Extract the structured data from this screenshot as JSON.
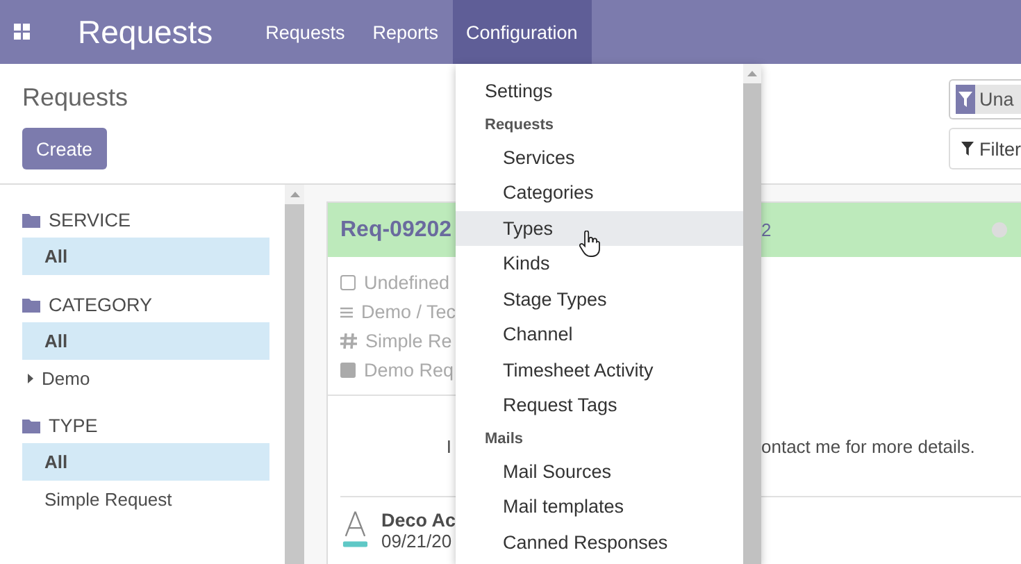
{
  "navbar": {
    "app_title": "Requests",
    "menus": [
      {
        "label": "Requests",
        "selected": false
      },
      {
        "label": "Reports",
        "selected": false
      },
      {
        "label": "Configuration",
        "selected": true
      }
    ]
  },
  "control_panel": {
    "breadcrumb": "Requests",
    "create_button": "Create",
    "search_facet": "Una",
    "filters_button": "Filter"
  },
  "sidebar": {
    "sections": [
      {
        "title": "SERVICE",
        "items": [
          {
            "kind": "leaf",
            "label": "All",
            "selected": true
          }
        ]
      },
      {
        "title": "CATEGORY",
        "items": [
          {
            "kind": "leaf",
            "label": "All",
            "selected": true
          },
          {
            "kind": "group",
            "label": "Demo",
            "selected": false
          }
        ]
      },
      {
        "title": "TYPE",
        "items": [
          {
            "kind": "leaf",
            "label": "All",
            "selected": true
          },
          {
            "kind": "leaf",
            "label": "Simple Request",
            "selected": false
          }
        ]
      }
    ]
  },
  "card": {
    "title_start": "Req-09202",
    "title_end": "2",
    "fields": [
      {
        "kind": "state",
        "text": "Undefined"
      },
      {
        "kind": "category",
        "text": "Demo / Tec"
      },
      {
        "kind": "type",
        "text": "Simple Re"
      },
      {
        "kind": "tag",
        "text": "Demo Req"
      }
    ],
    "description_start": "I",
    "description_end": "ontact me for more details.",
    "author": "Deco Ac",
    "date": "09/21/20"
  },
  "dropdown": {
    "items": [
      {
        "kind": "item",
        "label": "Settings",
        "selected": false
      },
      {
        "kind": "header",
        "label": "Requests",
        "selected": false
      },
      {
        "kind": "subitem",
        "label": "Services",
        "selected": false
      },
      {
        "kind": "subitem",
        "label": "Categories",
        "selected": false
      },
      {
        "kind": "subitem",
        "label": "Types",
        "selected": true
      },
      {
        "kind": "subitem",
        "label": "Kinds",
        "selected": false
      },
      {
        "kind": "subitem",
        "label": "Stage Types",
        "selected": false
      },
      {
        "kind": "subitem",
        "label": "Channel",
        "selected": false
      },
      {
        "kind": "subitem",
        "label": "Timesheet Activity",
        "selected": false
      },
      {
        "kind": "subitem",
        "label": "Request Tags",
        "selected": false
      },
      {
        "kind": "header",
        "label": "Mails",
        "selected": false
      },
      {
        "kind": "subitem",
        "label": "Mail Sources",
        "selected": false
      },
      {
        "kind": "subitem",
        "label": "Mail templates",
        "selected": false
      },
      {
        "kind": "subitem",
        "label": "Canned Responses",
        "selected": false
      }
    ]
  }
}
